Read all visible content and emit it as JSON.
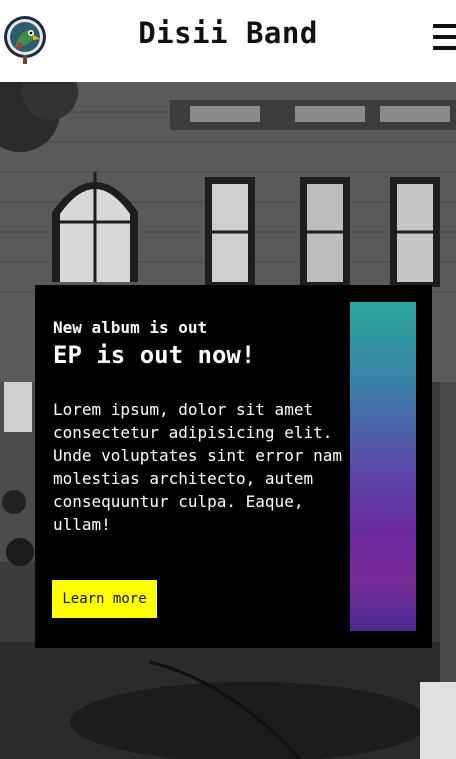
{
  "header": {
    "title": "Disii Band",
    "logo_icon": "parrot-logo-icon",
    "menu_icon": "hamburger-menu-icon"
  },
  "hero": {
    "background": "black-and-white street photo with brick building"
  },
  "card": {
    "kicker": "New album is out",
    "title": "EP is out now!",
    "body": "Lorem ipsum, dolor sit amet consectetur adipisicing elit. Unde voluptates sint error nam molestias architecto, autem consequuntur culpa. Eaque, ullam!",
    "button_label": "Learn more",
    "button_color": "#ffff00",
    "art": "album-cover-gradient"
  }
}
